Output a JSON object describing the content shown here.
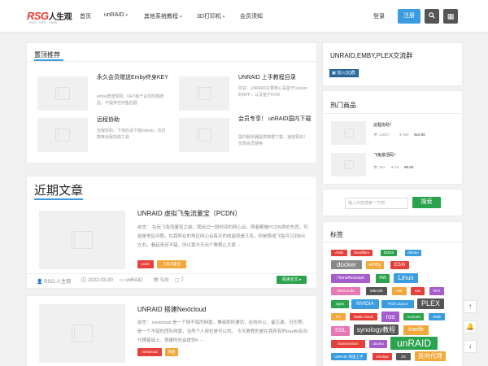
{
  "header": {
    "logo_en": "RSG",
    "logo_cn": "人生观",
    "logo_sub": "RSG · LIFE · VIEW",
    "nav": [
      {
        "label": "首页"
      },
      {
        "label": "unRAID"
      },
      {
        "label": "其他系统教程"
      },
      {
        "label": "3D打印机"
      },
      {
        "label": "会员须知"
      }
    ],
    "login": "登录",
    "register": "注册",
    "search_icon": "search-icon",
    "menu_icon": "grid-icon"
  },
  "featured": {
    "title": "置顶推荐",
    "posts": [
      {
        "title": "永久会员赠送Emby终身KEY",
        "desc": "emby赠送规则：KEY属于会员附属赠品，不提供任何售后服"
      },
      {
        "title": "UNRAID 上手教程目录",
        "desc": "前言：UNRAID主要核心是基于Docker的APP，以及基于KVM"
      },
      {
        "title": "远程协助",
        "desc": "远程协助，下单后请下载todesk。向日葵等远程协助工具"
      },
      {
        "title": "会员专享！ unRAID国内下载",
        "desc": "国内服务器提供数据下载，速度更快！仅限会员使用"
      }
    ]
  },
  "recent": {
    "title": "近期文章",
    "articles": [
      {
        "title": "UNRAID 虚拟飞兔流量宝（PCDN）",
        "desc": "前言： 在玩飞兔流量宝之前，我玩过一段时间的网心云，两者都是PCDN类的东西，可能是地区问题，在我所在的地区网心云每天的收益就是几毛，但是换成飞兔可以到8元左右，看起来还不错，所以我今天出个教程让大家 ···",
        "tags": [
          "pcdn",
          "飞兔流量宝"
        ],
        "author": "RSG-人生观",
        "date": "2022-03-30",
        "category": "unRAID",
        "views": "529",
        "comments": "7",
        "read": "阅读全文"
      },
      {
        "title": "UNRAID 搭建Nextcloud",
        "desc": "前言： nextcloud 是一个很不错的网盘，兼容即时通讯，在线办公，备忘录，日历等，是一个不错的团队网盘，当然个人用也是可以的。 今天教程的是在我所有的traefik反向代理基础上，搭建的也会提供h ···",
        "tags": [
          "nextcloud",
          "网盘"
        ]
      }
    ]
  },
  "sidebar": {
    "group_title": "UNRAID,EMBY,PLEX交流群",
    "qq_button": "加入QQ群",
    "shop_title": "热门商品",
    "products": [
      {
        "name": "远程协助！",
        "views": "13067",
        "likes": "289",
        "price": "10.00"
      },
      {
        "name": "飞兔激活码！",
        "views": "254",
        "likes": "28",
        "price": "9.00"
      }
    ],
    "search_placeholder": "输入内容搜索一下吧",
    "search_button": "搜索",
    "tags_title": "标签",
    "tags": [
      {
        "label": "AMD",
        "color": "#e5413a"
      },
      {
        "label": "cloudflare",
        "color": "#e5413a"
      },
      {
        "label": "DDNS",
        "color": "#2aa34c"
      },
      {
        "label": "debian",
        "color": "#3b9ddf"
      },
      {
        "label": "docker",
        "color": "#888888"
      },
      {
        "label": "emby",
        "color": "#f3a83b"
      },
      {
        "label": "ESXi",
        "color": "#e5413a"
      },
      {
        "label": "HomeAssistant",
        "color": "#a55ccc"
      },
      {
        "label": "HW",
        "color": "#2aa34c"
      },
      {
        "label": "Linux",
        "color": "#3b9ddf"
      },
      {
        "label": "MiniConda",
        "color": "#e877b6"
      },
      {
        "label": "Mikrotik",
        "color": "#555555"
      },
      {
        "label": "mtk",
        "color": "#f3a83b"
      },
      {
        "label": "nas",
        "color": "#e5413a"
      },
      {
        "label": "NFS",
        "color": "#a55ccc"
      },
      {
        "label": "ngins",
        "color": "#2aa34c"
      },
      {
        "label": "NVIDIA",
        "color": "#3b9ddf"
      },
      {
        "label": "PCB Layout",
        "color": "#3b9ddf"
      },
      {
        "label": "PLEX",
        "color": "#555555"
      },
      {
        "label": "PT",
        "color": "#f3a83b"
      },
      {
        "label": "Radio Sonic",
        "color": "#e5413a"
      },
      {
        "label": "ros",
        "color": "#a55ccc"
      },
      {
        "label": "roonmet",
        "color": "#2aa34c"
      },
      {
        "label": "SMB",
        "color": "#3b9ddf"
      },
      {
        "label": "SSL",
        "color": "#e877b6"
      },
      {
        "label": "synology教程",
        "color": "#555555"
      },
      {
        "label": "traefik",
        "color": "#f3a83b"
      },
      {
        "label": "transmission",
        "color": "#e5413a"
      },
      {
        "label": "ubuntu",
        "color": "#a55ccc"
      },
      {
        "label": "unRAID",
        "color": "#2aa34c"
      },
      {
        "label": "unRAID 快速上手",
        "color": "#3b9ddf"
      },
      {
        "label": "window",
        "color": "#e5413a"
      },
      {
        "label": "zfs",
        "color": "#555555"
      },
      {
        "label": "反向代理",
        "color": "#f3a83b"
      }
    ]
  },
  "tools": [
    "arrow-up-icon",
    "bell-icon",
    "arrow-down-icon"
  ]
}
